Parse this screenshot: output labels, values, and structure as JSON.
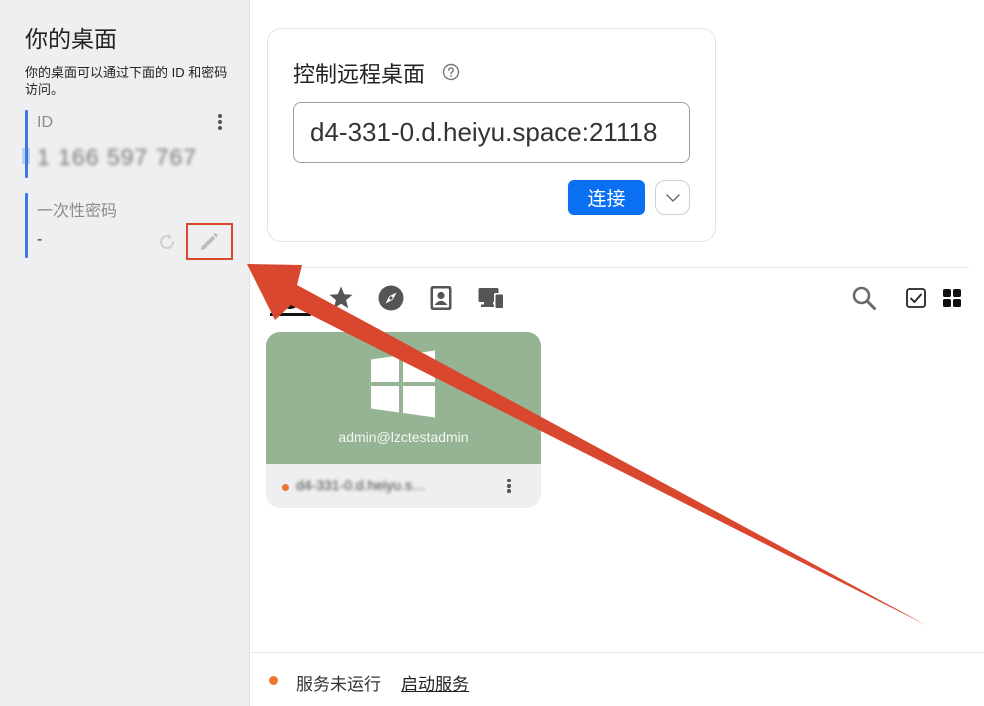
{
  "sidebar": {
    "title": "你的桌面",
    "description": "你的桌面可以通过下面的 ID 和密码访问。",
    "id_label": "ID",
    "id_value": "1 166 597 767",
    "password_label": "一次性密码",
    "password_value": "-"
  },
  "connect": {
    "title": "控制远程桌面",
    "address_value": "d4-331-0.d.heiyu.space:21118",
    "connect_label": "连接"
  },
  "tabs": [
    "recent-icon",
    "star-icon",
    "compass-icon",
    "address-book-icon",
    "lan-devices-icon"
  ],
  "peer": {
    "os_icon": "windows-icon",
    "user": "admin@lzctestadmin",
    "name": "d4-331-0.d.heiyu.s…",
    "status_color": "#f0762d"
  },
  "status": {
    "text": "服务未运行",
    "link": "启动服务"
  },
  "colors": {
    "accent": "#0a6ff0",
    "sidebar_bg": "#efeff1",
    "peer_card": "#95b493",
    "annotation": "#d9472f"
  }
}
